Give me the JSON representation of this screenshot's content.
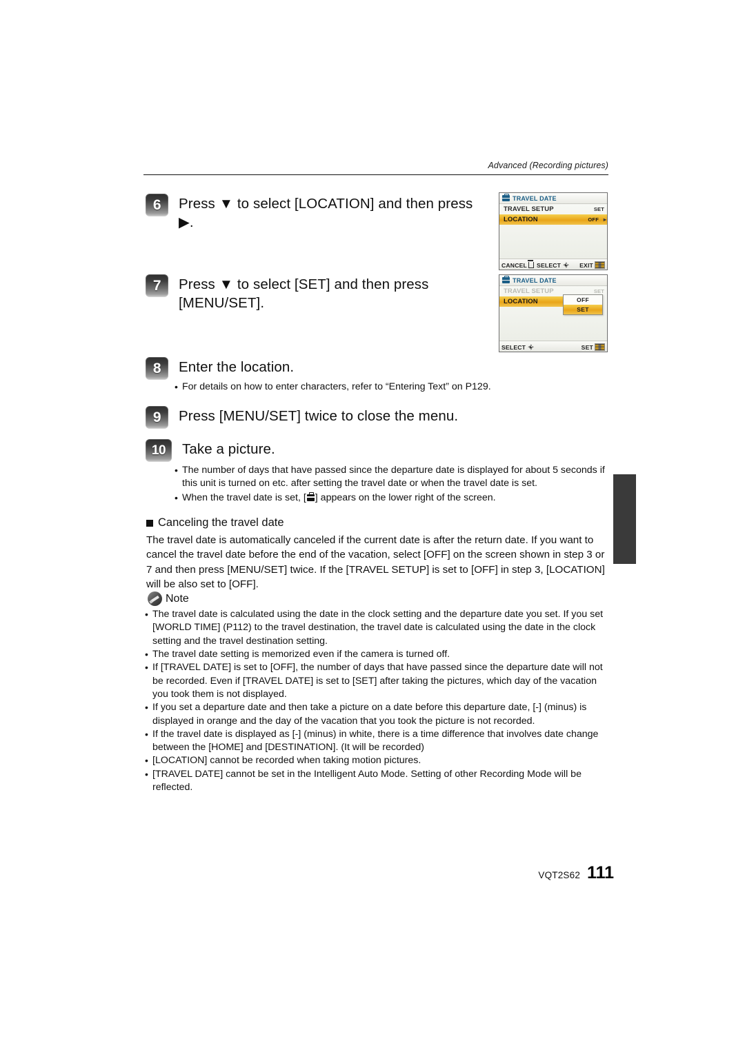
{
  "header": {
    "section_label": "Advanced (Recording pictures)"
  },
  "steps": [
    {
      "number": "6",
      "title": "Press ▼ to select [LOCATION] and then press ▶."
    },
    {
      "number": "7",
      "title": "Press ▼ to select [SET] and then press [MENU/SET]."
    },
    {
      "number": "8",
      "title": "Enter the location.",
      "bullets": [
        "For details on how to enter characters, refer to “Entering Text” on P129."
      ]
    },
    {
      "number": "9",
      "title": "Press [MENU/SET] twice to close the menu."
    },
    {
      "number": "10",
      "title": "Take a picture.",
      "bullets": [
        "The number of days that have passed since the departure date is displayed for about 5 seconds if this unit is turned on etc. after setting the travel date or when the travel date is set.",
        "When the travel date is set, [■] appears on the lower right of the screen."
      ]
    }
  ],
  "cancel_section": {
    "heading": "Canceling the travel date",
    "paragraph": "The travel date is automatically canceled if the current date is after the return date. If you want to cancel the travel date before the end of the vacation, select [OFF] on the screen shown in step 3 or 7 and then press [MENU/SET] twice. If the [TRAVEL SETUP] is set to [OFF] in step 3, [LOCATION] will be also set to [OFF]."
  },
  "note": {
    "heading": "Note",
    "items": [
      "The travel date is calculated using the date in the clock setting and the departure date you set. If you set [WORLD TIME] (P112) to the travel destination, the travel date is calculated using the date in the clock setting and the travel destination setting.",
      "The travel date setting is memorized even if the camera is turned off.",
      "If [TRAVEL DATE] is set to [OFF], the number of days that have passed since the departure date will not be recorded. Even if [TRAVEL DATE] is set to [SET] after taking the pictures, which day of the vacation you took them is not displayed.",
      "If you set a departure date and then take a picture on a date before this departure date, [-] (minus) is displayed in orange and the day of the vacation that you took the picture is not recorded.",
      "If the travel date is displayed as [-] (minus) in white, there is a time difference that involves date change between the [HOME] and [DESTINATION]. (It will be recorded)",
      "[LOCATION] cannot be recorded when taking motion pictures.",
      "[TRAVEL DATE] cannot be set in the Intelligent Auto Mode. Setting of other Recording Mode will be reflected."
    ]
  },
  "lcd_screens": [
    {
      "title": "TRAVEL DATE",
      "rows": [
        {
          "label": "TRAVEL SETUP",
          "value": "SET",
          "state": "normal"
        },
        {
          "label": "LOCATION",
          "value": "OFF",
          "state": "highlighted"
        }
      ],
      "footer": {
        "cancel_label": "CANCEL",
        "select_label": "SELECT",
        "exit_label": "EXIT"
      }
    },
    {
      "title": "TRAVEL DATE",
      "rows": [
        {
          "label": "TRAVEL SETUP",
          "value": "SET",
          "state": "dimmed"
        },
        {
          "label": "LOCATION",
          "value": "",
          "state": "highlighted"
        }
      ],
      "dropdown": [
        {
          "label": "OFF",
          "selected": false
        },
        {
          "label": "SET",
          "selected": true
        }
      ],
      "footer": {
        "select_label": "SELECT",
        "set_label": "SET"
      }
    }
  ],
  "footer": {
    "doc_code": "VQT2S62",
    "page_number": "111"
  },
  "colors": {
    "highlight_orange": "#e9a519",
    "lcd_title_blue": "#1b5e86",
    "edge_tab": "#3a3a3a"
  }
}
